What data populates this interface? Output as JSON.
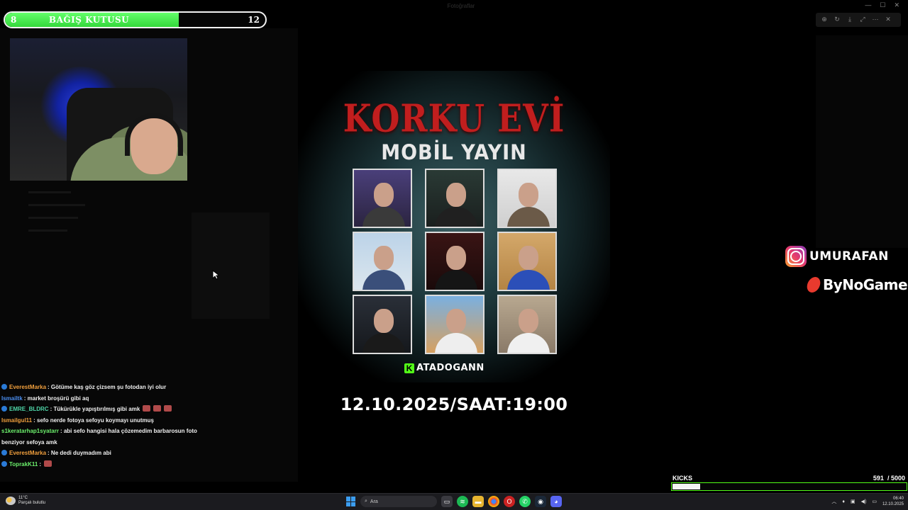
{
  "donation": {
    "title": "BAĞIŞ KUTUSU",
    "current": "8",
    "goal": "12",
    "progress": 0.667
  },
  "viewer": {
    "window_title": "Fotoğraflar",
    "tools": [
      "zoom-in-icon",
      "rotate-icon",
      "download-icon",
      "expand-icon",
      "more-icon",
      "close-icon"
    ]
  },
  "poster": {
    "title": "KORKU EVİ",
    "subtitle": "MOBİL YAYIN",
    "sponsor": "ATADOGANN",
    "sponsor_logo": "K",
    "date_time": "12.10.2025/SAAT:19:00",
    "title_color": "#c11e1e",
    "accent_color": "#53fc18"
  },
  "socials": {
    "instagram": "UMURAFAN",
    "sponsor_brand": "ByNoGame"
  },
  "kicks": {
    "label": "KICKS",
    "count": "591",
    "goal": "/ 5000",
    "progress": 0.118
  },
  "chat": [
    {
      "user": "EverestMarka",
      "color": "#f2a03d",
      "message": ": Götüme kaş göz çizsem şu fotodan iyi olur",
      "badge": true,
      "emotes": 0
    },
    {
      "user": "Ismailtk",
      "color": "#4a8ef0",
      "message": ": market broşürü gibi aq",
      "badge": false,
      "emotes": 0
    },
    {
      "user": "EMRE_BLDRC",
      "color": "#4fd6a8",
      "message": ": Tükürükle yapıştırılmış gibi amk",
      "badge": true,
      "emotes": 3
    },
    {
      "user": "Ismailgul11",
      "color": "#f2a03d",
      "message": ": sefo nerde fotoya sefoyu koymayı unutmuş",
      "badge": false,
      "emotes": 0
    },
    {
      "user": "s1keratarhap1syatarr",
      "color": "#6cf06c",
      "message": ": abi sefo hangisi hala çözemedim barbarosun foto benziyor sefoya amk",
      "badge": false,
      "emotes": 0
    },
    {
      "user": "EverestMarka",
      "color": "#f2a03d",
      "message": ": Ne dedi duymadım abi",
      "badge": true,
      "emotes": 0
    },
    {
      "user": "ToprakK11",
      "color": "#6cf06c",
      "message": ":",
      "badge": true,
      "emotes": 1
    }
  ],
  "taskbar": {
    "weather_temp": "11°C",
    "weather_desc": "Parçalı bulutlu",
    "search_placeholder": "Ara",
    "time": "06:40",
    "date": "12.10.2025"
  }
}
